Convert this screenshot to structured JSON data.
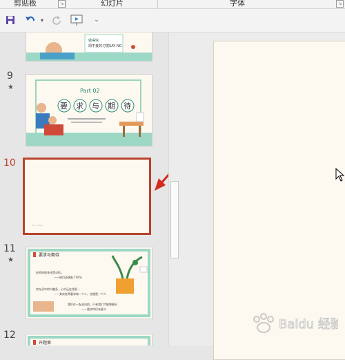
{
  "ribbon": {
    "groups": [
      "剪贴板",
      "幻灯片",
      "字体"
    ]
  },
  "slides": [
    {
      "number": "9",
      "has_animation": true,
      "title_part": "Part 02",
      "title_chars": [
        "要",
        "求",
        "与",
        "期",
        "待"
      ],
      "top_text": "做得快",
      "caption": "周不良的习惯SAY NO"
    },
    {
      "number": "10",
      "selected": true,
      "footer": "Bai du Edu"
    },
    {
      "number": "11",
      "has_animation": true,
      "heading": "要求与期待",
      "lines": [
        "老师的很多还是对的。",
        "——他们还想起了90%",
        "你在读中的兴趣多，心中还在找到...",
        "——其实老师要求每一个人，也就是一个人",
        "我们在一起走向前，只有我们才能够更好",
        "——要求你们有意义"
      ]
    },
    {
      "number": "12",
      "heading": "开题第"
    }
  ],
  "colors": {
    "accent": "#b8432c",
    "mint": "#9dd7c6"
  },
  "watermark": "Baidu 经验"
}
